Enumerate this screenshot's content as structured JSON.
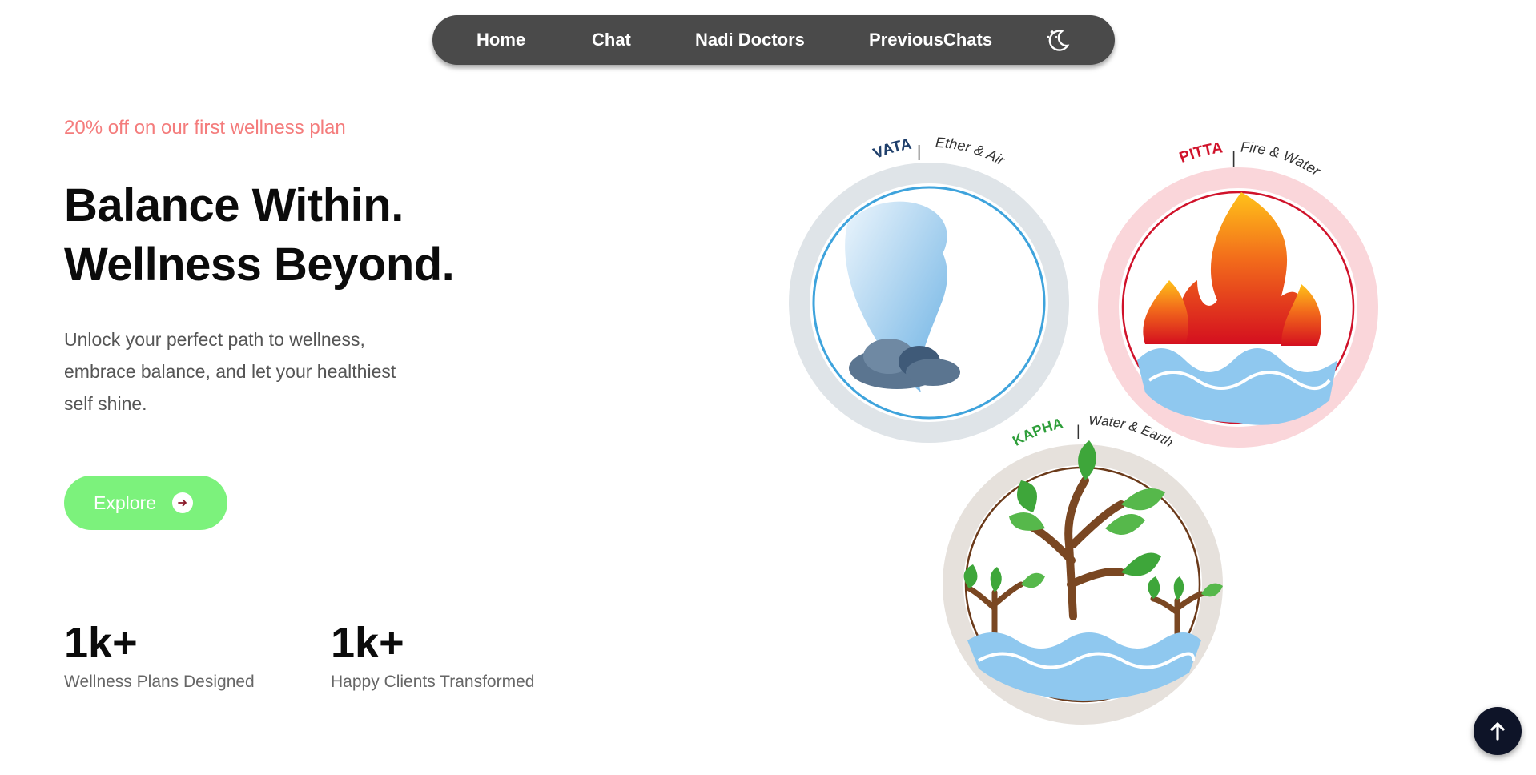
{
  "nav": {
    "items": [
      {
        "label": "Home"
      },
      {
        "label": "Chat"
      },
      {
        "label": "Nadi Doctors"
      },
      {
        "label": "PreviousChats"
      }
    ],
    "theme_icon": "moon-stars-icon"
  },
  "hero": {
    "offer": "20% off on our first wellness plan",
    "headline_line1": "Balance Within.",
    "headline_line2": "Wellness Beyond.",
    "tagline_line1": "Unlock your perfect path to wellness,",
    "tagline_line2": "embrace balance, and let your healthiest",
    "tagline_line3": "self shine.",
    "explore_label": "Explore"
  },
  "stats": [
    {
      "value": "1k+",
      "label": "Wellness Plans Designed"
    },
    {
      "value": "1k+",
      "label": "Happy Clients Transformed"
    }
  ],
  "doshas": {
    "vata": {
      "name": "VATA",
      "elements": "Ether & Air"
    },
    "pitta": {
      "name": "PITTA",
      "elements": "Fire & Water"
    },
    "kapha": {
      "name": "KAPHA",
      "elements": "Water & Earth"
    }
  },
  "colors": {
    "nav_bg": "#4a4a4a",
    "offer": "#f47c7c",
    "explore_bg": "#7cf27c",
    "scroll_top_bg": "#0e1428",
    "vata": "#1f3f6b",
    "pitta": "#d0122a",
    "kapha": "#2e9e3a"
  },
  "scroll_top_icon": "arrow-up-icon"
}
